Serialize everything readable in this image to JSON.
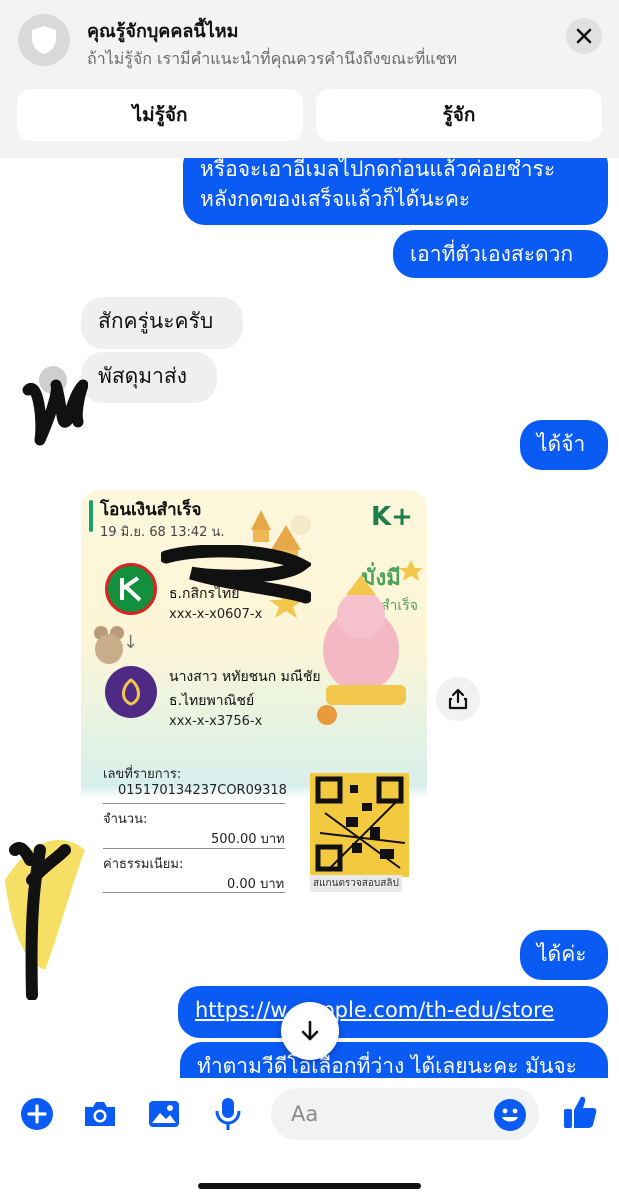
{
  "banner": {
    "title": "คุณรู้จักบุคคลนี้ไหม",
    "subtitle": "ถ้าไม่รู้จัก เรามีคำแนะนำที่คุณควรคำนึงถึงขณะที่แชท",
    "btn_no": "ไม่รู้จัก",
    "btn_yes": "รู้จัก",
    "icon": "shield-icon"
  },
  "messages": [
    {
      "from": "me",
      "text": "หรือจะเอาอีเมลไปกดก่อนแล้วค่อยชำระ"
    },
    {
      "from": "me",
      "text": "หลังกดของเสร็จแล้วก็ได้นะคะ"
    },
    {
      "from": "me",
      "text": "เอาที่ตัวเองสะดวก"
    },
    {
      "from": "them",
      "text": "สักครู่นะครับ"
    },
    {
      "from": "them",
      "text": "พัสดุมาส่ง"
    },
    {
      "from": "me",
      "text": "ได้จ้า"
    },
    {
      "from": "me",
      "text": "ได้ค่ะ"
    },
    {
      "from": "me",
      "text": "https://www.apple.com/th-edu/store",
      "visible_text": "https://w…apple.com/th-edu/store"
    },
    {
      "from": "me",
      "text": "ทำตามวีดีโอเลือกที่ว่าง ได้เลยนะคะ มันจะ"
    }
  ],
  "slip": {
    "title": "โอนเงินสำเร็จ",
    "datetime": "19 มิ.ย. 68  13:42 น.",
    "brand": "K+",
    "sender_bank": "ธ.กสิกรไทย",
    "sender_account": "xxx-x-x0607-x",
    "receiver_name": "นางสาว หทัยชนก มณีชัย",
    "receiver_bank": "ธ.ไทยพาณิชย์",
    "receiver_account": "xxx-x-x3756-x",
    "ref_label": "เลขที่รายการ:",
    "ref_value": "015170134237COR09318",
    "amount_label": "จำนวน:",
    "amount_value": "500.00 บาท",
    "fee_label": "ค่าธรรมเนียม:",
    "fee_value": "0.00 บาท",
    "qr_caption": "สแกนตรวจสอบสลิป",
    "deco_text": "มั่งมี",
    "deco_text2": "สำเร็จ"
  },
  "composer": {
    "placeholder": "Aa",
    "icons": [
      "plus-icon",
      "camera-icon",
      "image-icon",
      "microphone-icon",
      "emoji-icon",
      "thumbs-up-icon"
    ]
  },
  "colors": {
    "accent": "#0a5af4",
    "incoming": "#eeeff1",
    "banner_bg": "#f3f3f4"
  }
}
